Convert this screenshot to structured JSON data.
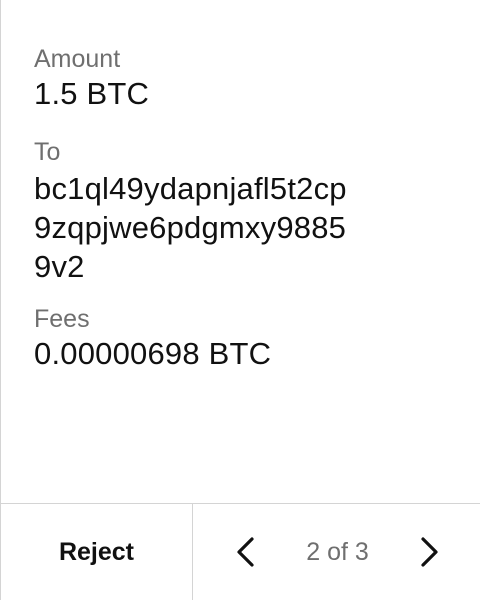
{
  "transaction": {
    "amount": {
      "label": "Amount",
      "value": "1.5 BTC"
    },
    "to": {
      "label": "To",
      "value_lines": [
        "bc1ql49ydapnjafl5t2cp",
        "9zqpjwe6pdgmxy9885",
        "9v2"
      ]
    },
    "fees": {
      "label": "Fees",
      "value": "0.00000698 BTC"
    }
  },
  "footer": {
    "reject_label": "Reject",
    "pager": {
      "label": "2 of 3",
      "prev_icon": "chevron-left-icon",
      "next_icon": "chevron-right-icon"
    }
  }
}
